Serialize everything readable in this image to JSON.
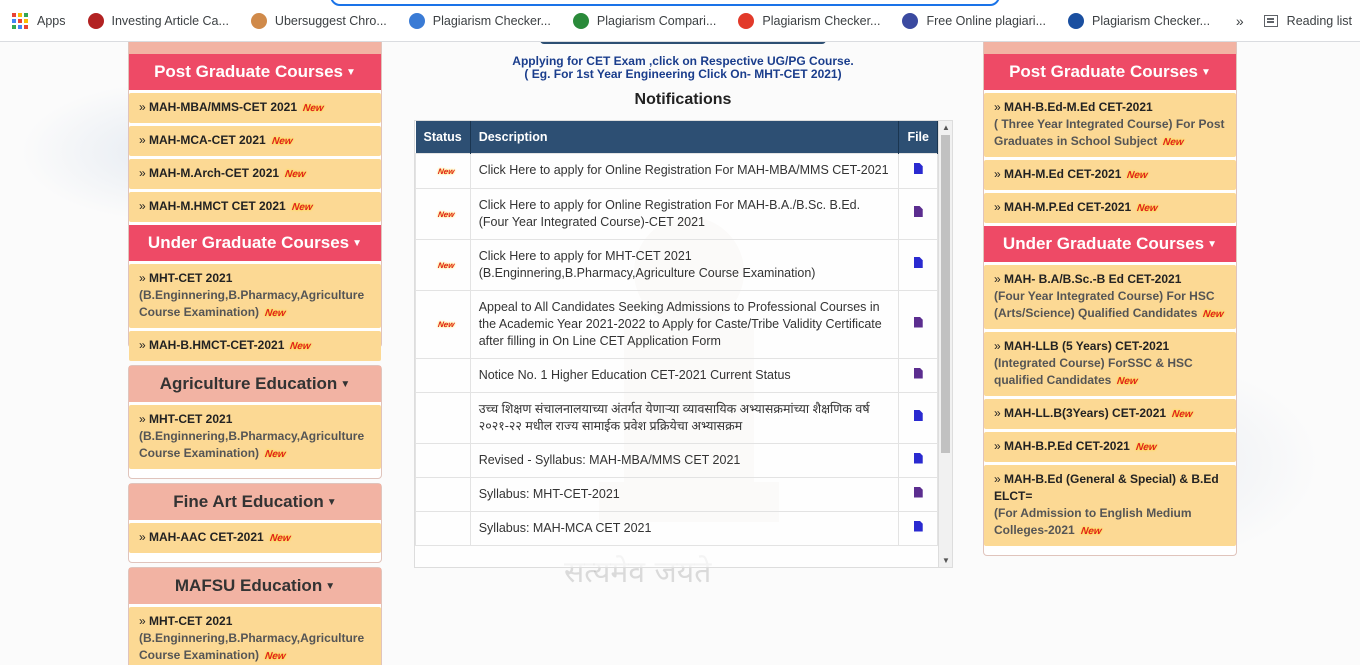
{
  "browser": {
    "bookmarks": [
      {
        "label": "Apps",
        "icon": "apps-grid-icon"
      },
      {
        "label": "Investing Article Ca...",
        "icon": "investing-icon",
        "color": "#b22222"
      },
      {
        "label": "Ubersuggest Chro...",
        "icon": "ubersuggest-avatar-icon",
        "color": "#d08a4a"
      },
      {
        "label": "Plagiarism Checker...",
        "icon": "plagiarism-icon",
        "color": "#3a7bd5"
      },
      {
        "label": "Plagiarism Compari...",
        "icon": "pr-icon",
        "color": "#2a8a3a"
      },
      {
        "label": "Plagiarism Checker...",
        "icon": "checker-icon",
        "color": "#e23a2a"
      },
      {
        "label": "Free Online plagiari...",
        "icon": "doc-icon",
        "color": "#3b4aa0"
      },
      {
        "label": "Plagiarism Checker...",
        "icon": "globe-icon",
        "color": "#1a4fa0"
      }
    ],
    "more_label": "»",
    "reading_list_label": "Reading list"
  },
  "left": {
    "postgrad": {
      "title": "Post Graduate Courses",
      "items": [
        {
          "label": "MAH-MBA/MMS-CET 2021",
          "new": "New"
        },
        {
          "label": "MAH-MCA-CET 2021",
          "new": "New"
        },
        {
          "label": "MAH-M.Arch-CET 2021",
          "new": "New"
        },
        {
          "label": "MAH-M.HMCT CET 2021",
          "new": "New"
        }
      ]
    },
    "undergrad": {
      "title": "Under Graduate Courses",
      "items": [
        {
          "label": "MHT-CET 2021",
          "sub": "(B.Enginnering,B.Pharmacy,Agriculture Course Examination)",
          "new": "New"
        },
        {
          "label": "MAH-B.HMCT-CET-2021",
          "new": "New"
        }
      ]
    },
    "agri": {
      "title": "Agriculture Education",
      "items": [
        {
          "label": "MHT-CET 2021",
          "sub": "(B.Enginnering,B.Pharmacy,Agriculture Course Examination)",
          "new": "New"
        }
      ]
    },
    "fineart": {
      "title": "Fine Art Education",
      "items": [
        {
          "label": "MAH-AAC CET-2021",
          "new": "New"
        }
      ]
    },
    "mafsu": {
      "title": "MAFSU Education",
      "items": [
        {
          "label": "MHT-CET 2021",
          "sub": "(B.Enginnering,B.Pharmacy,Agriculture Course Examination)",
          "new": "New"
        }
      ]
    }
  },
  "center": {
    "apply_line1": "Applying for CET Exam ,click on Respective UG/PG Course.",
    "apply_line2": "( Eg. For 1st Year Engineering Click On- MHT-CET 2021)",
    "notifications_title": "Notifications",
    "table": {
      "headers": [
        "Status",
        "Description",
        "File"
      ],
      "rows": [
        {
          "new": "New",
          "desc": "Click Here to apply for Online Registration For MAH-MBA/MMS CET-2021",
          "file_color": "#2a2ad0"
        },
        {
          "new": "New",
          "desc": "Click Here to apply for Online Registration For MAH-B.A./B.Sc. B.Ed. (Four Year Integrated Course)-CET 2021",
          "file_color": "#5b2d8f"
        },
        {
          "new": "New",
          "desc": "Click Here to apply for MHT-CET 2021 (B.Enginnering,B.Pharmacy,Agriculture Course Examination)",
          "file_color": "#2a2ad0"
        },
        {
          "new": "New",
          "desc": "Appeal to All Candidates Seeking Admissions to Professional Courses in the Academic Year 2021-2022 to Apply for Caste/Tribe Validity Certificate after filling in On Line CET Application Form",
          "file_color": "#5b2d8f"
        },
        {
          "new": "",
          "desc": "Notice No. 1 Higher Education CET-2021 Current Status",
          "file_color": "#5b2d8f"
        },
        {
          "new": "",
          "desc": "उच्च शिक्षण संचालनालयाच्या अंतर्गत येणाऱ्या व्यावसायिक अभ्यासक्रमांच्या शैक्षणिक वर्ष २०२१-२२ मधील राज्य सामाईक प्रवेश प्रक्रियेचा अभ्यासक्रम",
          "file_color": "#2a2ad0"
        },
        {
          "new": "",
          "desc": "Revised - Syllabus: MAH-MBA/MMS CET 2021",
          "file_color": "#2a2ad0"
        },
        {
          "new": "",
          "desc": "Syllabus: MHT-CET-2021",
          "file_color": "#5b2d8f"
        },
        {
          "new": "",
          "desc": "Syllabus: MAH-MCA CET 2021",
          "file_color": "#2a2ad0"
        }
      ]
    },
    "motto": "सत्यमेव जयते"
  },
  "right": {
    "postgrad": {
      "title": "Post Graduate Courses",
      "items": [
        {
          "label": "MAH-B.Ed-M.Ed CET-2021",
          "sub": "( Three Year Integrated Course) For Post Graduates in School Subject",
          "new": "New"
        },
        {
          "label": "MAH-M.Ed CET-2021",
          "new": "New"
        },
        {
          "label": "MAH-M.P.Ed CET-2021",
          "new": "New"
        }
      ]
    },
    "undergrad": {
      "title": "Under Graduate Courses",
      "items": [
        {
          "label": "MAH- B.A/B.Sc.-B Ed CET-2021",
          "sub": "(Four Year Integrated Course) For HSC (Arts/Science) Qualified Candidates",
          "new": "New"
        },
        {
          "label": "MAH-LLB (5 Years) CET-2021",
          "sub": "(Integrated Course) ForSSC & HSC qualified Candidates",
          "new": "New"
        },
        {
          "label": "MAH-LL.B(3Years) CET-2021",
          "new": "New"
        },
        {
          "label": "MAH-B.P.Ed CET-2021",
          "new": "New"
        },
        {
          "label": "MAH-B.Ed (General & Special) & B.Ed ELCT=",
          "sub": "(For Admission to English Medium Colleges-2021",
          "new": "New"
        }
      ]
    }
  },
  "colors": {
    "pink_header": "#ee4a66",
    "salmon_header": "#f2b3a3",
    "item_bg": "#fcd994",
    "table_header": "#2d4f73"
  }
}
